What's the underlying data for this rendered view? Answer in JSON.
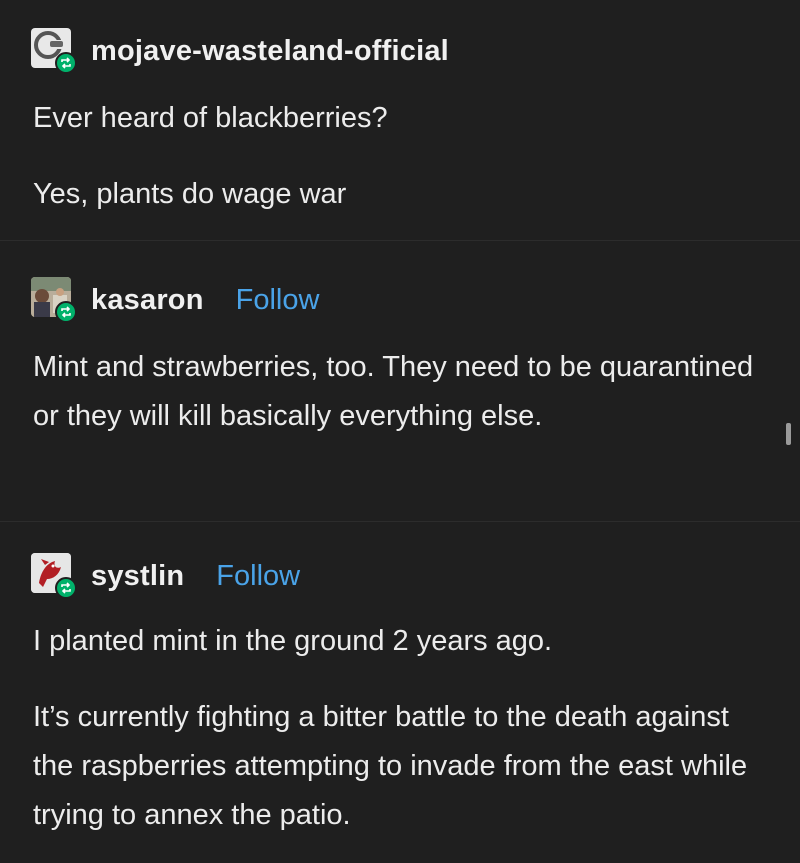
{
  "posts": [
    {
      "username": "mojave-wasteland-official",
      "avatar_icon": "mojave-avatar-icon",
      "paragraphs": [
        "Ever heard of blackberries?",
        "Yes, plants do wage war"
      ]
    },
    {
      "username": "kasaron",
      "follow_label": "Follow",
      "avatar_icon": "kasaron-avatar-icon",
      "paragraphs": [
        "Mint and strawberries, too. They need to be quarantined or they will kill basically everything else."
      ]
    },
    {
      "username": "systlin",
      "follow_label": "Follow",
      "avatar_icon": "systlin-avatar-icon",
      "paragraphs": [
        "I planted mint in the ground 2 years ago.",
        "It’s currently fighting a bitter battle to the death against the raspberries attempting to invade from the east while trying to annex the patio."
      ]
    }
  ],
  "colors": {
    "background": "#1f1f1f",
    "text": "#ececec",
    "follow": "#4aa3e8",
    "reblog_badge": "#00b16a"
  }
}
